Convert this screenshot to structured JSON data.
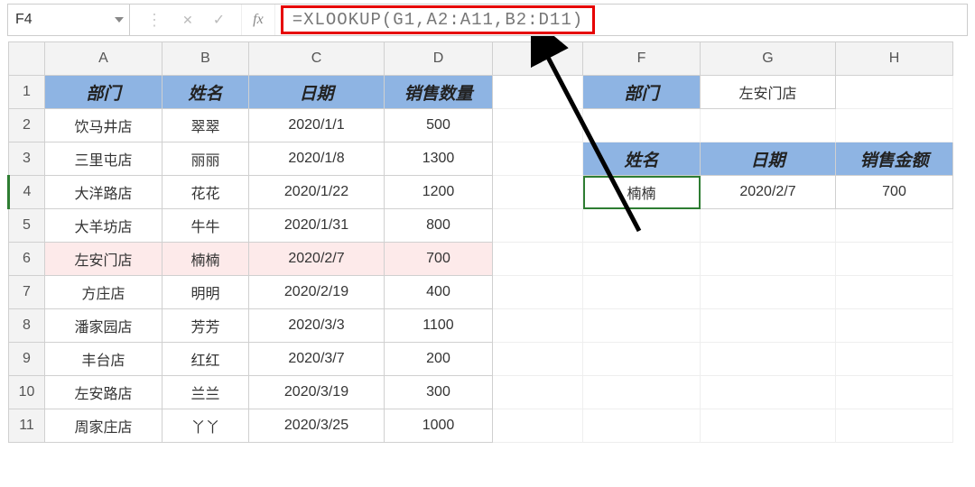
{
  "name_box": "F4",
  "fx_label": "fx",
  "formula": "=XLOOKUP(G1,A2:A11,B2:D11)",
  "columns": [
    "A",
    "B",
    "C",
    "D",
    "E",
    "F",
    "G",
    "H"
  ],
  "row_numbers": [
    1,
    2,
    3,
    4,
    5,
    6,
    7,
    8,
    9,
    10,
    11
  ],
  "main_headers": {
    "A": "部门",
    "B": "姓名",
    "C": "日期",
    "D": "销售数量"
  },
  "main_rows": [
    {
      "dept": "饮马井店",
      "name": "翠翠",
      "date": "2020/1/1",
      "qty": "500"
    },
    {
      "dept": "三里屯店",
      "name": "丽丽",
      "date": "2020/1/8",
      "qty": "1300"
    },
    {
      "dept": "大洋路店",
      "name": "花花",
      "date": "2020/1/22",
      "qty": "1200"
    },
    {
      "dept": "大羊坊店",
      "name": "牛牛",
      "date": "2020/1/31",
      "qty": "800"
    },
    {
      "dept": "左安门店",
      "name": "楠楠",
      "date": "2020/2/7",
      "qty": "700"
    },
    {
      "dept": "方庄店",
      "name": "明明",
      "date": "2020/2/19",
      "qty": "400"
    },
    {
      "dept": "潘家园店",
      "name": "芳芳",
      "date": "2020/3/3",
      "qty": "1100"
    },
    {
      "dept": "丰台店",
      "name": "红红",
      "date": "2020/3/7",
      "qty": "200"
    },
    {
      "dept": "左安路店",
      "name": "兰兰",
      "date": "2020/3/19",
      "qty": "300"
    },
    {
      "dept": "周家庄店",
      "name": "丫丫",
      "date": "2020/3/25",
      "qty": "1000"
    }
  ],
  "lookup_header": {
    "F": "部门"
  },
  "lookup_value": {
    "G": "左安门店"
  },
  "result_headers": {
    "F": "姓名",
    "G": "日期",
    "H": "销售金额"
  },
  "result_row": {
    "F": "楠楠",
    "G": "2020/2/7",
    "H": "700"
  },
  "highlight_row_index": 4,
  "active_row": 4,
  "active_cell": "F4"
}
